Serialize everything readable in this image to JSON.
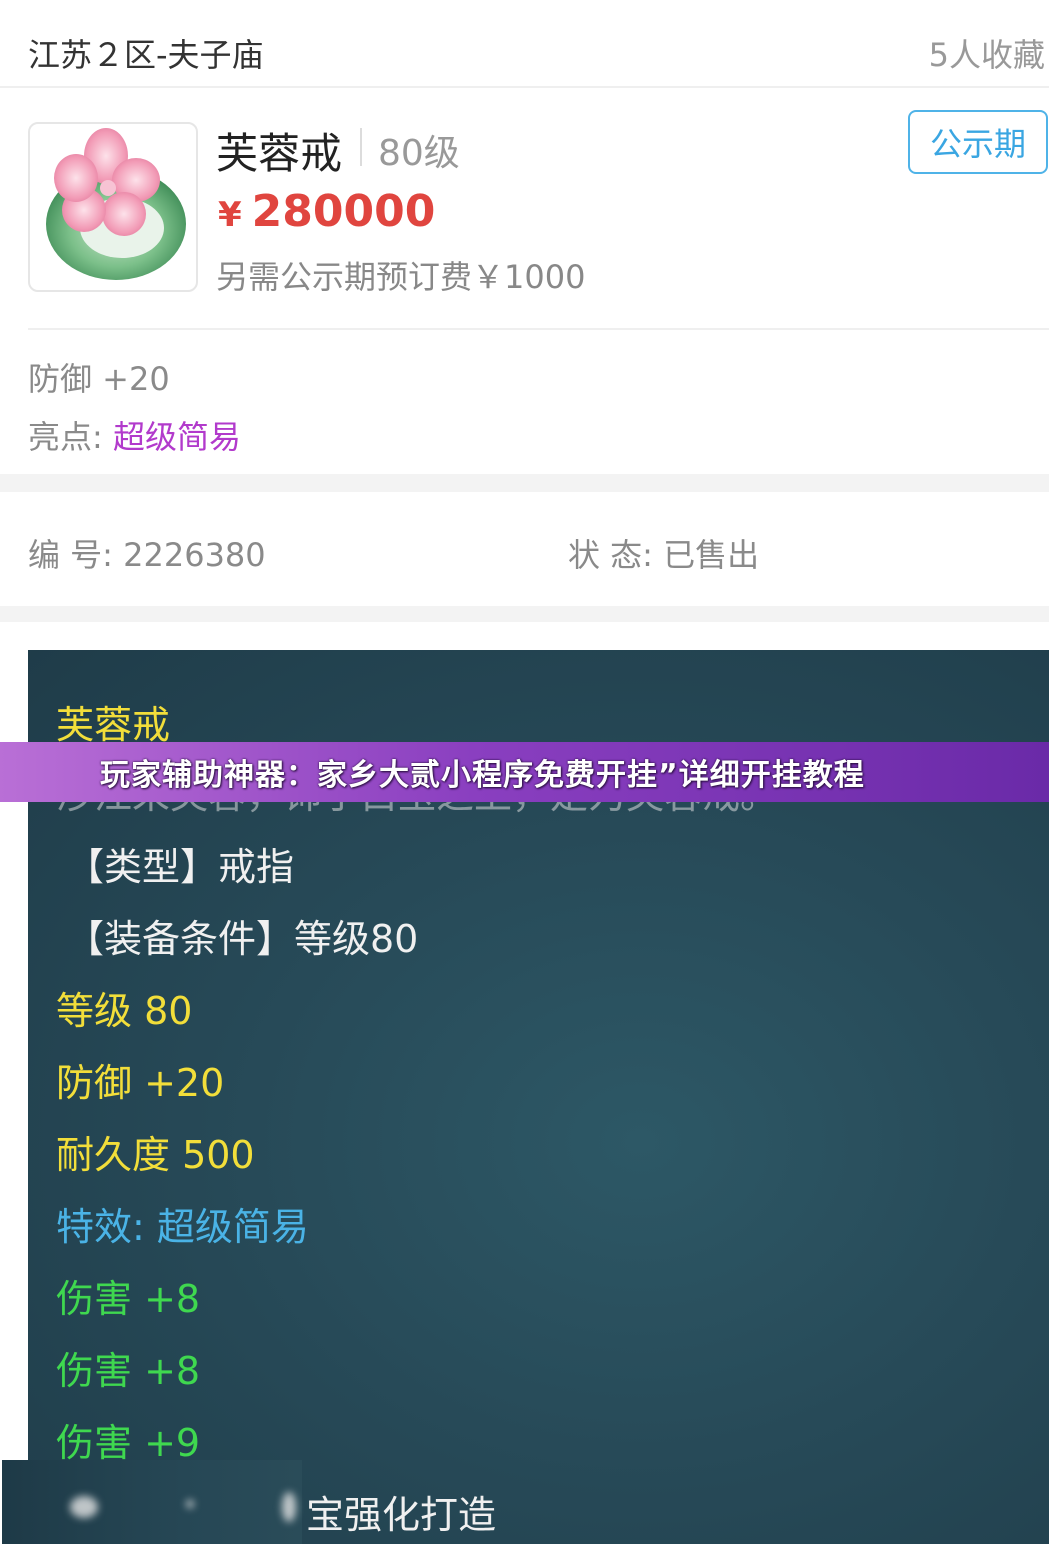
{
  "header": {
    "server": "江苏２区-夫子庙",
    "favorites": "5人收藏"
  },
  "item": {
    "name": "芙蓉戒",
    "level": "80级",
    "price_symbol": "¥",
    "price": "280000",
    "fee": "另需公示期预订费￥1000",
    "status_badge": "公示期",
    "defense": "防御 +20",
    "highlight_label": "亮点:",
    "highlight_value": "超级简易"
  },
  "meta": {
    "serial": "编 号:  2226380",
    "state": "状 态:  已售出"
  },
  "tooltip": {
    "title": "芙蓉戒",
    "desc": "涉江采芙蓉，饰于白玉之上，是为芙蓉戒。",
    "type": "【类型】戒指",
    "requirement": "【装备条件】等级80",
    "level": "等级 80",
    "defense": "防御 +20",
    "durability": "耐久度 500",
    "effect": "特效:  超级简易",
    "damage1": "伤害 +8",
    "damage2": "伤害 +8",
    "damage3": "伤害 +9",
    "forge": "宝强化打造"
  },
  "banner": {
    "text": "玩家辅助神器：家乡大贰小程序免费开挂”详细开挂教程"
  },
  "colors": {
    "price": "#e0453f",
    "badge": "#3aa6e2",
    "highlight": "#b23acc",
    "tooltip_yellow": "#f2de3a",
    "tooltip_blue": "#4ab3e6",
    "tooltip_green": "#3fd84f",
    "banner": "#8a3fc0"
  },
  "icons": {
    "item_image": "jade-ring-with-pink-flower-icon"
  }
}
